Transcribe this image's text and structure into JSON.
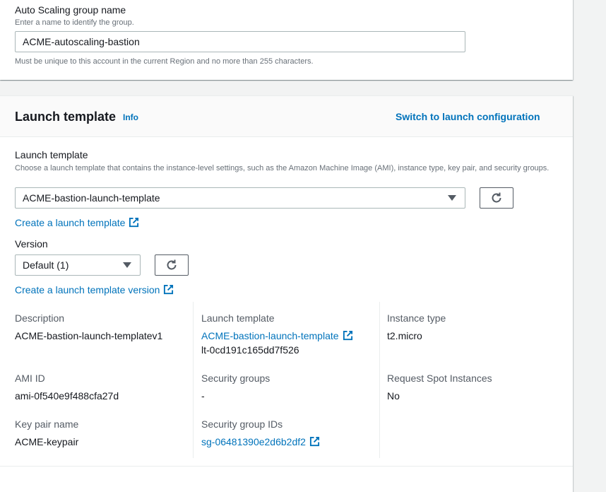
{
  "asg": {
    "label": "Auto Scaling group name",
    "hint": "Enter a name to identify the group.",
    "value": "ACME-autoscaling-bastion",
    "constraint": "Must be unique to this account in the current Region and no more than 255 characters."
  },
  "launch_template_section": {
    "title": "Launch template",
    "info": "Info",
    "switch_link": "Switch to launch configuration",
    "field_label": "Launch template",
    "field_hint": "Choose a launch template that contains the instance-level settings, such as the Amazon Machine Image (AMI), instance type, key pair, and security groups.",
    "selected_template": "ACME-bastion-launch-template",
    "create_template_link": "Create a launch template",
    "version_label": "Version",
    "version_selected": "Default (1)",
    "create_version_link": "Create a launch template version"
  },
  "details": {
    "description_label": "Description",
    "description_value": "ACME-bastion-launch-templatev1",
    "launch_template_label": "Launch template",
    "launch_template_link": "ACME-bastion-launch-template",
    "launch_template_id": "lt-0cd191c165dd7f526",
    "instance_type_label": "Instance type",
    "instance_type_value": "t2.micro",
    "ami_label": "AMI ID",
    "ami_value": "ami-0f540e9f488cfa27d",
    "security_groups_label": "Security groups",
    "security_groups_value": "-",
    "spot_label": "Request Spot Instances",
    "spot_value": "No",
    "keypair_label": "Key pair name",
    "keypair_value": "ACME-keypair",
    "sg_ids_label": "Security group IDs",
    "sg_ids_link": "sg-06481390e2d6b2df2"
  },
  "icons": {
    "refresh": "refresh-icon",
    "external": "external-link-icon",
    "dropdown": "caret-down-icon"
  },
  "colors": {
    "link": "#0073bb",
    "text": "#16191f",
    "muted": "#687078",
    "background": "#f2f3f3"
  }
}
